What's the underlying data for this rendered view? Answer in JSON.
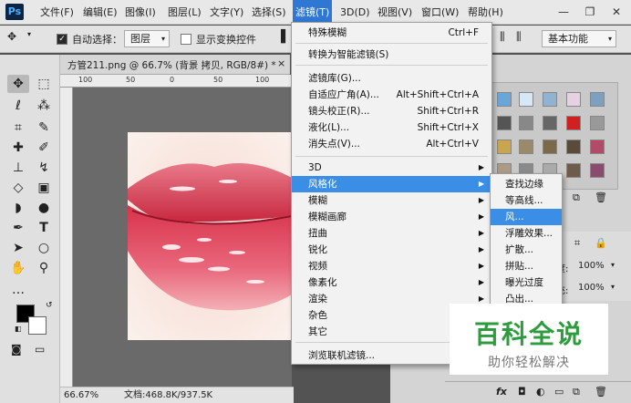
{
  "app": {
    "logo": "Ps"
  },
  "menubar": {
    "items": [
      "文件(F)",
      "编辑(E)",
      "图像(I)",
      "图层(L)",
      "文字(Y)",
      "选择(S)",
      "滤镜(T)",
      "3D(D)",
      "视图(V)",
      "窗口(W)",
      "帮助(H)"
    ],
    "active": "滤镜(T)"
  },
  "window_controls": {
    "minimize": "—",
    "restore": "❐",
    "close": "✕"
  },
  "options_bar": {
    "auto_select_label": "自动选择：",
    "auto_select_value": "图层",
    "show_transform_label": "显示变换控件",
    "workspace": "基本功能"
  },
  "document": {
    "tab_title": "方管211.png @ 66.7% (背景 拷贝, RGB/8#) *",
    "tab_close": "×",
    "ruler_ticks": [
      "100",
      "50",
      "0",
      "50",
      "100"
    ],
    "zoom": "66.67%",
    "doc_size": "文档:468.8K/937.5K"
  },
  "filter_menu": {
    "items": [
      {
        "label": "特殊模糊",
        "shortcut": "Ctrl+F"
      },
      {
        "label": "转换为智能滤镜(S)",
        "shortcut": ""
      },
      {
        "label": "滤镜库(G)...",
        "shortcut": ""
      },
      {
        "label": "自适应广角(A)...",
        "shortcut": "Alt+Shift+Ctrl+A"
      },
      {
        "label": "镜头校正(R)...",
        "shortcut": "Shift+Ctrl+R"
      },
      {
        "label": "液化(L)...",
        "shortcut": "Shift+Ctrl+X"
      },
      {
        "label": "消失点(V)...",
        "shortcut": "Alt+Ctrl+V"
      },
      {
        "label": "3D",
        "shortcut": ""
      },
      {
        "label": "风格化",
        "shortcut": ""
      },
      {
        "label": "模糊",
        "shortcut": ""
      },
      {
        "label": "模糊画廊",
        "shortcut": ""
      },
      {
        "label": "扭曲",
        "shortcut": ""
      },
      {
        "label": "锐化",
        "shortcut": ""
      },
      {
        "label": "视频",
        "shortcut": ""
      },
      {
        "label": "像素化",
        "shortcut": ""
      },
      {
        "label": "渲染",
        "shortcut": ""
      },
      {
        "label": "杂色",
        "shortcut": ""
      },
      {
        "label": "其它",
        "shortcut": ""
      },
      {
        "label": "浏览联机滤镜...",
        "shortcut": ""
      }
    ]
  },
  "stylize_submenu": {
    "items": [
      "查找边缘",
      "等高线...",
      "风...",
      "浮雕效果...",
      "扩散...",
      "拼贴...",
      "曝光过度",
      "凸出..."
    ],
    "highlighted": "风..."
  },
  "layers_panel": {
    "opacity_label": "度:",
    "opacity_value": "100%",
    "fill_label": "充:",
    "fill_value": "100%",
    "fx_label": "fx"
  },
  "watermark": {
    "title": "百科全说",
    "subtitle": "助你轻松解决"
  }
}
